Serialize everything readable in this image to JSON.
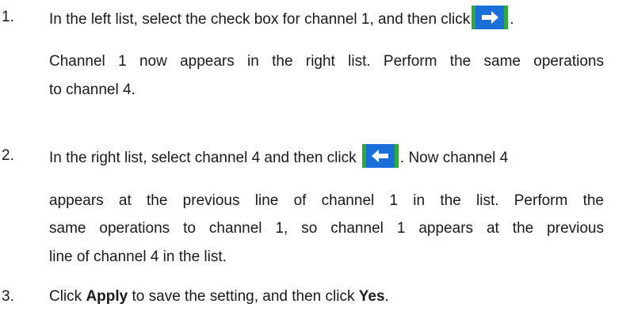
{
  "steps": [
    {
      "number": "1.",
      "line1_before": "In the left list, select the check box for channel 1, and then click",
      "line1_after": ".",
      "icon": "arrow-right-icon",
      "para_line1": "Channel 1 now appears in the right list. Perform the same operations",
      "para_line2": "to channel 4."
    },
    {
      "number": "2.",
      "line1_before": "In the right list, select channel 4 and then click",
      "line1_after": ". Now channel 4",
      "icon": "arrow-left-icon",
      "para_line1": "appears at the previous line of channel 1 in the list. Perform the",
      "para_line2": "same operations to channel 1, so channel 1 appears at the previous",
      "para_line3": "line of channel 4 in the list."
    },
    {
      "number": "3.",
      "text_before": "Click ",
      "bold1": "Apply",
      "text_middle": " to save the setting, and then click ",
      "bold2": "Yes",
      "text_after": "."
    }
  ],
  "colors": {
    "button_blue": "#1a6ed8",
    "button_green": "#2faa3a",
    "arrow_white": "#ffffff"
  }
}
